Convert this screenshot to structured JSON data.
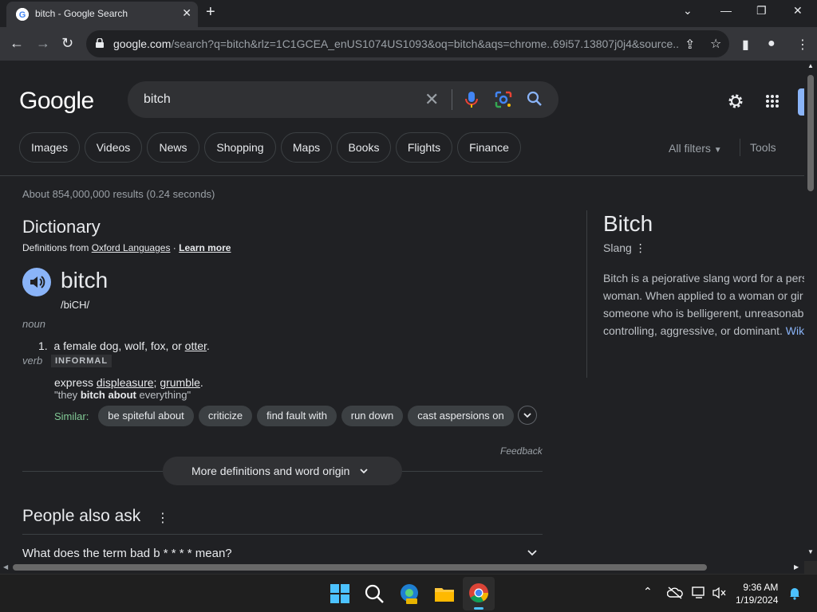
{
  "browser": {
    "tab_title": "bitch - Google Search",
    "url_host": "google.com",
    "url_rest": "/search?q=bitch&rlz=1C1GCEA_enUS1074US1093&oq=bitch&aqs=chrome..69i57.13807j0j4&source..."
  },
  "search": {
    "logo": "Google",
    "query": "bitch",
    "chips": [
      "Images",
      "Videos",
      "News",
      "Shopping",
      "Maps",
      "Books",
      "Flights",
      "Finance"
    ],
    "all_filters": "All filters",
    "tools": "Tools",
    "stats": "About 854,000,000 results (0.24 seconds)"
  },
  "dictionary": {
    "title": "Dictionary",
    "source_prefix": "Definitions from ",
    "source_name": "Oxford Languages",
    "source_sep": " · ",
    "learn_more": "Learn more",
    "word": "bitch",
    "phonetic": "/biCH/",
    "pos_noun": "noun",
    "noun_def_num": "1.",
    "noun_def_text": "a female dog, wolf, fox, or ",
    "noun_def_link": "otter",
    "noun_def_end": ".",
    "pos_verb": "verb",
    "informal": "INFORMAL",
    "verb_def_pre": "express ",
    "verb_def_link1": "displeasure",
    "verb_def_mid": "; ",
    "verb_def_link2": "grumble",
    "verb_def_end": ".",
    "example_pre": "\"they ",
    "example_bold": "bitch about",
    "example_post": " everything\"",
    "similar_label": "Similar:",
    "similar": [
      "be spiteful about",
      "criticize",
      "find fault with",
      "run down",
      "cast aspersions on"
    ],
    "feedback": "Feedback",
    "more_defs": "More definitions and word origin"
  },
  "people_also_ask": {
    "title": "People also ask",
    "questions": [
      "What does the term bad b * * * * mean?"
    ]
  },
  "knowledge_panel": {
    "title": "Bitch",
    "subtitle": "Slang",
    "lines": [
      "Bitch is a pejorative slang word for a pers",
      "woman. When applied to a woman or gir",
      "someone who is belligerent, unreasonab",
      "controlling, aggressive, or dominant. "
    ],
    "link": "Wik"
  },
  "taskbar": {
    "time": "9:36 AM",
    "date": "1/19/2024"
  },
  "colors": {
    "background": "#202124",
    "link": "#8ab4f8",
    "similar": "#81c995"
  }
}
